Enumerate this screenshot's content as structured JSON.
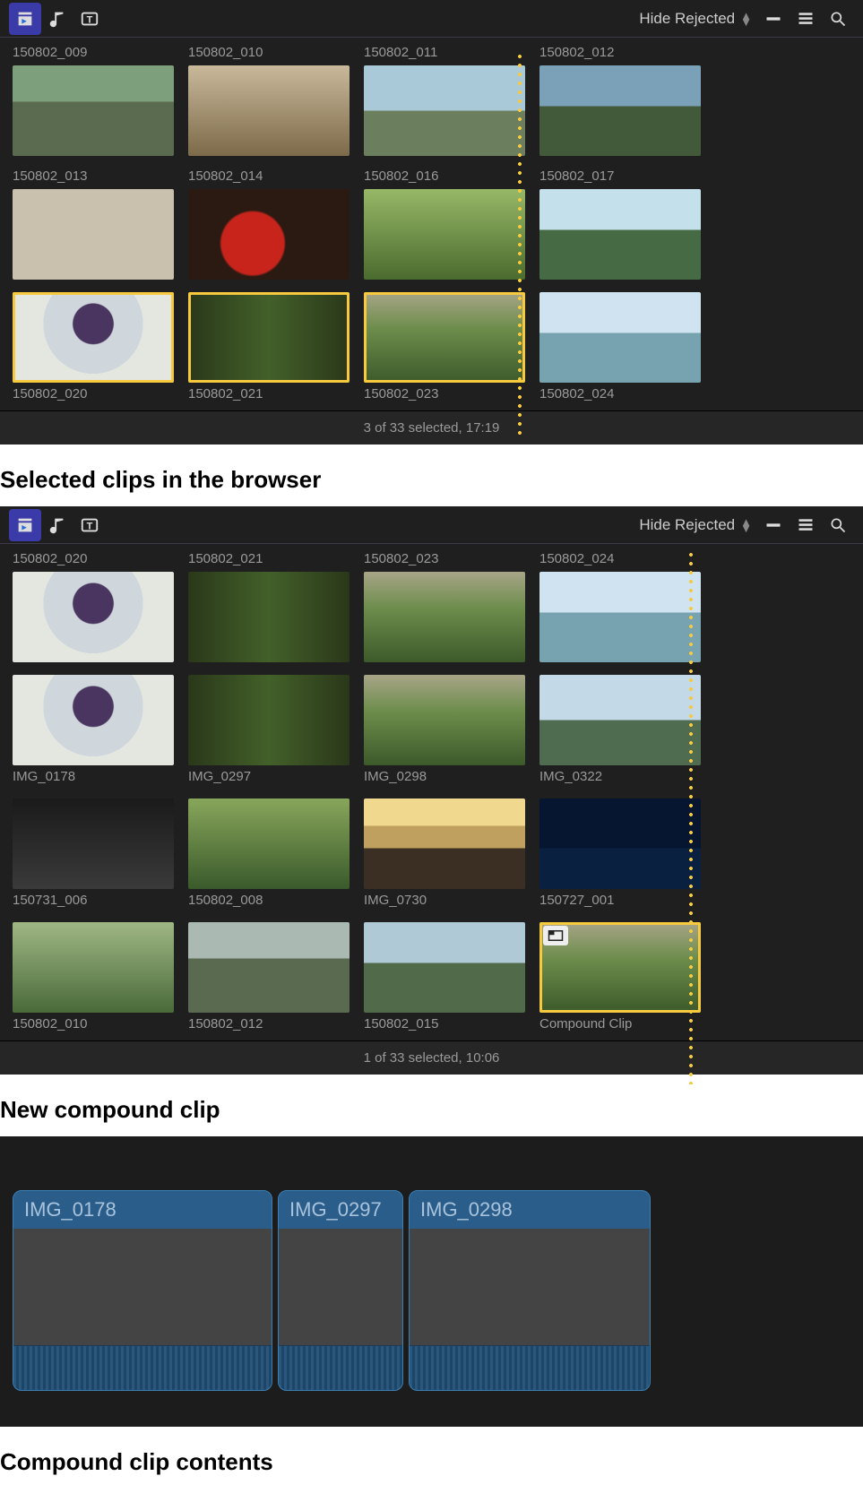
{
  "toolbar": {
    "filter_label": "Hide Rejected"
  },
  "captions": {
    "selected_browser": "Selected clips in the browser",
    "new_compound": "New compound clip",
    "compound_contents": "Compound clip contents"
  },
  "panel1": {
    "clips": [
      {
        "name": "150802_009",
        "ph": "ph-a",
        "sel": false
      },
      {
        "name": "150802_010",
        "ph": "ph-w",
        "sel": false
      },
      {
        "name": "150802_011",
        "ph": "ph-e",
        "sel": false
      },
      {
        "name": "150802_012",
        "ph": "ph-d",
        "sel": false
      },
      {
        "name": "150802_013",
        "ph": "ph-g",
        "sel": false
      },
      {
        "name": "150802_014",
        "ph": "ph-b",
        "sel": false
      },
      {
        "name": "150802_016",
        "ph": "ph-c",
        "sel": false
      },
      {
        "name": "150802_017",
        "ph": "ph-f",
        "sel": false
      },
      {
        "name": "150802_020",
        "ph": "ph-k",
        "sel": true
      },
      {
        "name": "150802_021",
        "ph": "ph-i",
        "sel": true
      },
      {
        "name": "150802_023",
        "ph": "ph-j",
        "sel": true
      },
      {
        "name": "150802_024",
        "ph": "ph-s",
        "sel": false
      }
    ],
    "status": "3 of 33 selected, 17:19"
  },
  "panel2": {
    "clips": [
      {
        "name": "150802_020",
        "ph": "ph-k",
        "sel": false
      },
      {
        "name": "150802_021",
        "ph": "ph-i",
        "sel": false
      },
      {
        "name": "150802_023",
        "ph": "ph-j",
        "sel": false
      },
      {
        "name": "150802_024",
        "ph": "ph-s",
        "sel": false
      },
      {
        "name": "IMG_0178",
        "ph": "ph-k",
        "sel": false
      },
      {
        "name": "IMG_0297",
        "ph": "ph-i",
        "sel": false
      },
      {
        "name": "IMG_0298",
        "ph": "ph-j",
        "sel": false
      },
      {
        "name": "IMG_0322",
        "ph": "ph-t",
        "sel": false
      },
      {
        "name": "150731_006",
        "ph": "ph-m",
        "sel": false
      },
      {
        "name": "150802_008",
        "ph": "ph-n",
        "sel": false
      },
      {
        "name": "IMG_0730",
        "ph": "ph-o",
        "sel": false
      },
      {
        "name": "150727_001",
        "ph": "ph-p",
        "sel": false
      },
      {
        "name": "150802_010",
        "ph": "ph-q",
        "sel": false
      },
      {
        "name": "150802_012",
        "ph": "ph-r",
        "sel": false
      },
      {
        "name": "150802_015",
        "ph": "ph-v",
        "sel": false
      },
      {
        "name": "Compound Clip",
        "ph": "ph-j",
        "sel": true,
        "compound": true
      }
    ],
    "status": "1 of 33 selected, 10:06"
  },
  "timeline": {
    "clips": [
      {
        "name": "IMG_0178",
        "w": "w1"
      },
      {
        "name": "IMG_0297",
        "w": "w2"
      },
      {
        "name": "IMG_0298",
        "w": "w3"
      }
    ]
  }
}
